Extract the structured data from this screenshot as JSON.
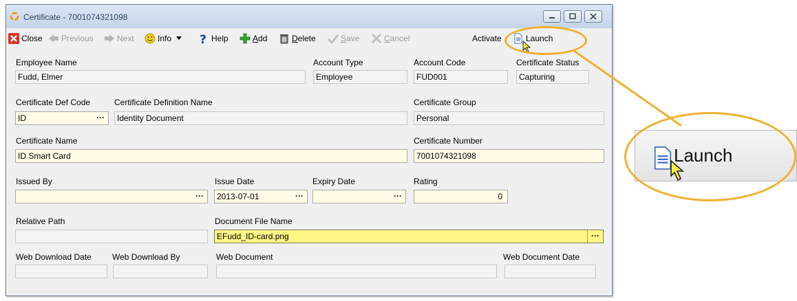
{
  "window": {
    "title": "Certificate - 7001074321098"
  },
  "toolbar": {
    "close": "Close",
    "previous": "Previous",
    "next": "Next",
    "info": "Info",
    "help": "Help",
    "add_prefix": "",
    "add_u": "A",
    "add_rest": "dd",
    "delete_u": "D",
    "delete_rest": "elete",
    "save_u": "S",
    "save_rest": "ave",
    "cancel_u": "C",
    "cancel_rest": "ancel",
    "activate": "Activate",
    "launch": "Launch"
  },
  "zoom": {
    "launch": "Launch"
  },
  "form": {
    "employee_name_label": "Employee Name",
    "employee_name": "Fudd, Elmer",
    "account_type_label": "Account Type",
    "account_type": "Employee",
    "account_code_label": "Account Code",
    "account_code": "FUD001",
    "status_label": "Certificate Status",
    "status": "Capturing",
    "def_code_label": "Certificate Def Code",
    "def_code": "ID",
    "def_name_label": "Certificate Definition Name",
    "def_name": "Identity Document",
    "group_label": "Certificate Group",
    "group": "Personal",
    "cert_name_label": "Certificate Name",
    "cert_name": "ID Smart Card",
    "cert_number_label": "Certificate Number",
    "cert_number": "7001074321098",
    "issued_by_label": "Issued By",
    "issued_by": "",
    "issue_date_label": "Issue Date",
    "issue_date": "2013-07-01",
    "expiry_date_label": "Expiry Date",
    "expiry_date": "",
    "rating_label": "Rating",
    "rating": "0",
    "relative_path_label": "Relative Path",
    "relative_path": "",
    "doc_file_label": "Document File Name",
    "doc_file": "EFudd_ID-card.png",
    "web_dl_date_label": "Web Download Date",
    "web_dl_by_label": "Web Download By",
    "web_doc_label": "Web Document",
    "web_doc_date_label": "Web Document Date",
    "ellipsis": "···"
  },
  "colors": {
    "callout": "#f0b030",
    "highlight_field": "#fff685",
    "titlebar": "#c5d5ea"
  }
}
